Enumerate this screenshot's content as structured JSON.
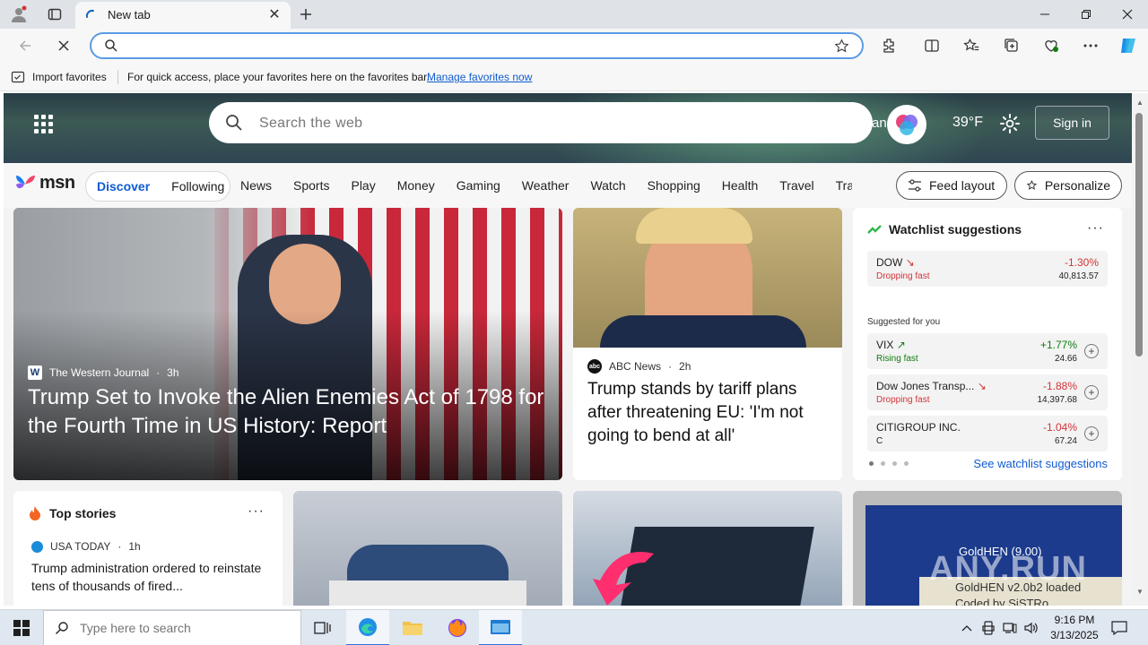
{
  "browser": {
    "tab_title": "New tab",
    "address_placeholder": "",
    "favorites_bar": {
      "import_label": "Import favorites",
      "hint": "For quick access, place your favorites here on the favorites bar.",
      "manage_link": "Manage favorites now"
    }
  },
  "hero": {
    "search_placeholder": "Search the web",
    "partial_text": "an",
    "weather": "39°F",
    "sign_in": "Sign in"
  },
  "nav": {
    "logo": "msn",
    "pills": [
      "Discover",
      "Following"
    ],
    "links": [
      "News",
      "Sports",
      "Play",
      "Money",
      "Gaming",
      "Weather",
      "Watch",
      "Shopping",
      "Health",
      "Travel",
      "Tra"
    ],
    "feed_layout": "Feed layout",
    "personalize": "Personalize"
  },
  "main_story": {
    "source": "The Western Journal",
    "age": "3h",
    "title": "Trump Set to Invoke the Alien Enemies Act of 1798 for the Fourth Time in US History: Report"
  },
  "second_story": {
    "source": "ABC News",
    "age": "2h",
    "title": "Trump stands by tariff plans after threatening EU: 'I'm not going to bend at all'"
  },
  "watchlist": {
    "title": "Watchlist suggestions",
    "more": "···",
    "suggested_label": "Suggested for you",
    "see_link": "See watchlist suggestions",
    "stocks": [
      {
        "name": "DOW",
        "trend": "Dropping fast",
        "change": "-1.30%",
        "value": "40,813.57",
        "dir": "down"
      },
      {
        "name": "VIX",
        "trend": "Rising fast",
        "change": "+1.77%",
        "value": "24.66",
        "dir": "up"
      },
      {
        "name": "Dow Jones Transp...",
        "trend": "Dropping fast",
        "change": "-1.88%",
        "value": "14,397.68",
        "dir": "down"
      },
      {
        "name": "CITIGROUP INC.",
        "trend": "C",
        "change": "-1.04%",
        "value": "67.24",
        "dir": "down"
      }
    ]
  },
  "top_stories": {
    "title": "Top stories",
    "more": "···",
    "source": "USA TODAY",
    "age": "1h",
    "headline": "Trump administration ordered to reinstate tens of thousands of fired..."
  },
  "tile_text": {
    "goldhen": "GoldHEN (9.00)",
    "goldhen_sub1": "GoldHEN v2.0b2 loaded",
    "goldhen_sub2": "Coded by SiSTRo",
    "watermark": "ANY.RUN"
  },
  "taskbar": {
    "search_placeholder": "Type here to search",
    "time": "9:16 PM",
    "date": "3/13/2025"
  }
}
